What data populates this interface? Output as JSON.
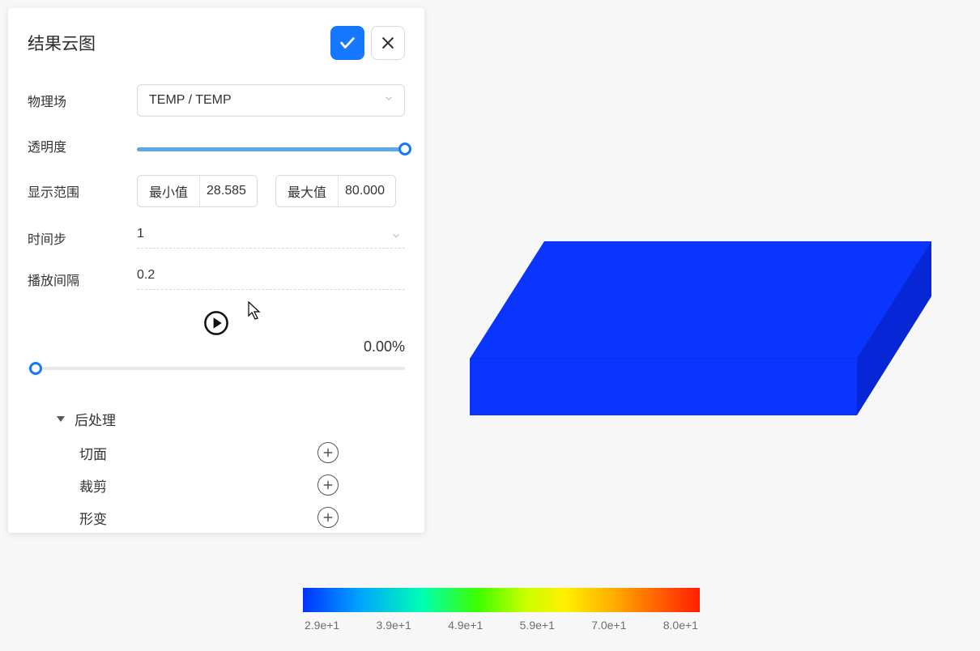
{
  "panel": {
    "title": "结果云图",
    "labels": {
      "physics": "物理场",
      "opacity": "透明度",
      "range": "显示范围",
      "min": "最小值",
      "max": "最大值",
      "timestep": "时间步",
      "interval": "播放间隔"
    },
    "physics_value": "TEMP / TEMP",
    "min_value": "28.585",
    "max_value": "80.000",
    "timestep_value": "1",
    "interval_value": "0.2",
    "progress_text": "0.00%",
    "tree": {
      "parent": "后处理",
      "items": [
        "切面",
        "裁剪",
        "形变"
      ]
    }
  },
  "legend": {
    "ticks": [
      "2.9e+1",
      "3.9e+1",
      "4.9e+1",
      "5.9e+1",
      "7.0e+1",
      "8.0e+1"
    ]
  }
}
